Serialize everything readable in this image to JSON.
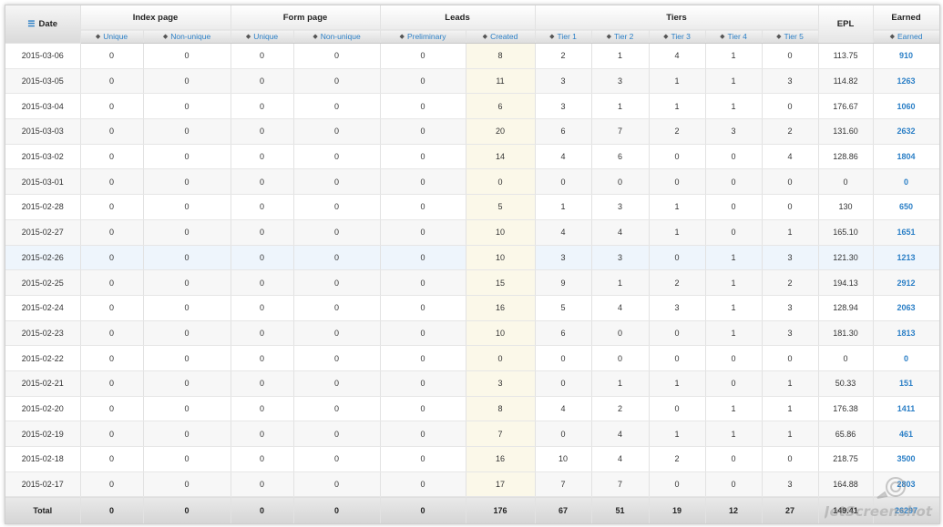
{
  "header": {
    "date": "Date",
    "groups": [
      "Index page",
      "Form page",
      "Leads",
      "Tiers",
      "EPL",
      "Earned"
    ],
    "sub": {
      "index_unique": "Unique",
      "index_nonunique": "Non-unique",
      "form_unique": "Unique",
      "form_nonunique": "Non-unique",
      "preliminary": "Preliminary",
      "created": "Created",
      "tier1": "Tier 1",
      "tier2": "Tier 2",
      "tier3": "Tier 3",
      "tier4": "Tier 4",
      "tier5": "Tier 5",
      "earned": "Earned"
    }
  },
  "rows": [
    [
      "2015-03-06",
      "0",
      "0",
      "0",
      "0",
      "0",
      "8",
      "2",
      "1",
      "4",
      "1",
      "0",
      "113.75",
      "910"
    ],
    [
      "2015-03-05",
      "0",
      "0",
      "0",
      "0",
      "0",
      "11",
      "3",
      "3",
      "1",
      "1",
      "3",
      "114.82",
      "1263"
    ],
    [
      "2015-03-04",
      "0",
      "0",
      "0",
      "0",
      "0",
      "6",
      "3",
      "1",
      "1",
      "1",
      "0",
      "176.67",
      "1060"
    ],
    [
      "2015-03-03",
      "0",
      "0",
      "0",
      "0",
      "0",
      "20",
      "6",
      "7",
      "2",
      "3",
      "2",
      "131.60",
      "2632"
    ],
    [
      "2015-03-02",
      "0",
      "0",
      "0",
      "0",
      "0",
      "14",
      "4",
      "6",
      "0",
      "0",
      "4",
      "128.86",
      "1804"
    ],
    [
      "2015-03-01",
      "0",
      "0",
      "0",
      "0",
      "0",
      "0",
      "0",
      "0",
      "0",
      "0",
      "0",
      "0",
      "0"
    ],
    [
      "2015-02-28",
      "0",
      "0",
      "0",
      "0",
      "0",
      "5",
      "1",
      "3",
      "1",
      "0",
      "0",
      "130",
      "650"
    ],
    [
      "2015-02-27",
      "0",
      "0",
      "0",
      "0",
      "0",
      "10",
      "4",
      "4",
      "1",
      "0",
      "1",
      "165.10",
      "1651"
    ],
    [
      "2015-02-26",
      "0",
      "0",
      "0",
      "0",
      "0",
      "10",
      "3",
      "3",
      "0",
      "1",
      "3",
      "121.30",
      "1213"
    ],
    [
      "2015-02-25",
      "0",
      "0",
      "0",
      "0",
      "0",
      "15",
      "9",
      "1",
      "2",
      "1",
      "2",
      "194.13",
      "2912"
    ],
    [
      "2015-02-24",
      "0",
      "0",
      "0",
      "0",
      "0",
      "16",
      "5",
      "4",
      "3",
      "1",
      "3",
      "128.94",
      "2063"
    ],
    [
      "2015-02-23",
      "0",
      "0",
      "0",
      "0",
      "0",
      "10",
      "6",
      "0",
      "0",
      "1",
      "3",
      "181.30",
      "1813"
    ],
    [
      "2015-02-22",
      "0",
      "0",
      "0",
      "0",
      "0",
      "0",
      "0",
      "0",
      "0",
      "0",
      "0",
      "0",
      "0"
    ],
    [
      "2015-02-21",
      "0",
      "0",
      "0",
      "0",
      "0",
      "3",
      "0",
      "1",
      "1",
      "0",
      "1",
      "50.33",
      "151"
    ],
    [
      "2015-02-20",
      "0",
      "0",
      "0",
      "0",
      "0",
      "8",
      "4",
      "2",
      "0",
      "1",
      "1",
      "176.38",
      "1411"
    ],
    [
      "2015-02-19",
      "0",
      "0",
      "0",
      "0",
      "0",
      "7",
      "0",
      "4",
      "1",
      "1",
      "1",
      "65.86",
      "461"
    ],
    [
      "2015-02-18",
      "0",
      "0",
      "0",
      "0",
      "0",
      "16",
      "10",
      "4",
      "2",
      "0",
      "0",
      "218.75",
      "3500"
    ],
    [
      "2015-02-17",
      "0",
      "0",
      "0",
      "0",
      "0",
      "17",
      "7",
      "7",
      "0",
      "0",
      "3",
      "164.88",
      "2803"
    ]
  ],
  "total": [
    "Total",
    "0",
    "0",
    "0",
    "0",
    "0",
    "176",
    "67",
    "51",
    "19",
    "12",
    "27",
    "149.41",
    "26297"
  ],
  "highlight_row": 8,
  "watermark": "JetScreenshot",
  "colors": {
    "accent": "#2b7fc6",
    "created_bg": "#fbf8e9",
    "highlight_bg": "#eef5fc"
  }
}
